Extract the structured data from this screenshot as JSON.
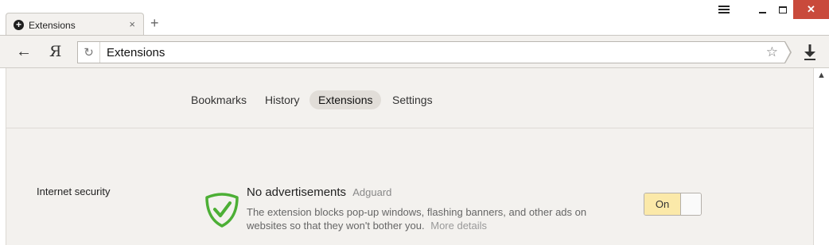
{
  "tab": {
    "title": "Extensions",
    "close": "×",
    "icon": "plus-circle-icon"
  },
  "new_tab": "+",
  "window": {
    "close": "✕"
  },
  "toolbar": {
    "back": "←",
    "yandex": "Я",
    "reload": "↻",
    "address_value": "Extensions",
    "star": "☆"
  },
  "nav": {
    "items": [
      {
        "label": "Bookmarks"
      },
      {
        "label": "History"
      },
      {
        "label": "Extensions"
      },
      {
        "label": "Settings"
      }
    ]
  },
  "section": {
    "label": "Internet security"
  },
  "extension": {
    "title": "No advertisements",
    "vendor": "Adguard",
    "description": "The extension blocks pop-up windows, flashing banners, and other ads on websites so that they won't bother you.",
    "more": "More details",
    "toggle_label": "On",
    "enabled": true
  },
  "scroll_up": "▲",
  "colors": {
    "toggle_on": "#fbe9a9",
    "shield": "#4caf35",
    "close_button": "#c94a3b"
  }
}
